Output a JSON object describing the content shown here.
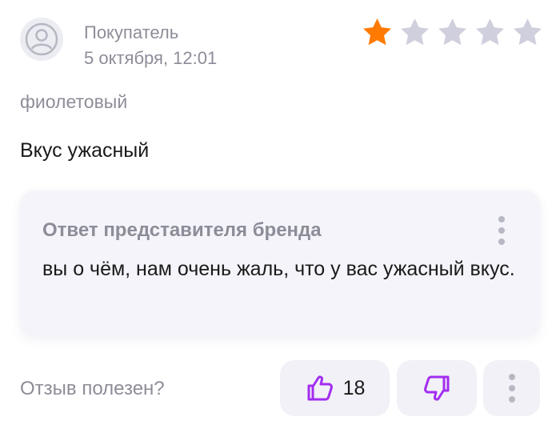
{
  "review": {
    "author": "Покупатель",
    "date": "5 октября, 12:01",
    "rating": 1,
    "rating_max": 5,
    "variant": "фиолетовый",
    "text": "Вкус ужасный"
  },
  "brand_reply": {
    "title": "Ответ представителя бренда",
    "text": "вы о чём, нам очень жаль, что у вас ужасный вкус."
  },
  "feedback": {
    "question": "Отзыв полезен?",
    "likes": "18"
  },
  "icons": {
    "avatar": "user-circle-icon",
    "star_filled": "star-filled-icon",
    "star_empty": "star-empty-icon",
    "like": "thumbs-up-icon",
    "dislike": "thumbs-down-icon",
    "more": "more-vertical-icon"
  },
  "colors": {
    "star_filled": "#ff7a00",
    "star_empty": "#cfcfdd",
    "accent_purple": "#a32df0",
    "muted_text": "#8d8d99",
    "card_bg": "#f4f4fa"
  }
}
